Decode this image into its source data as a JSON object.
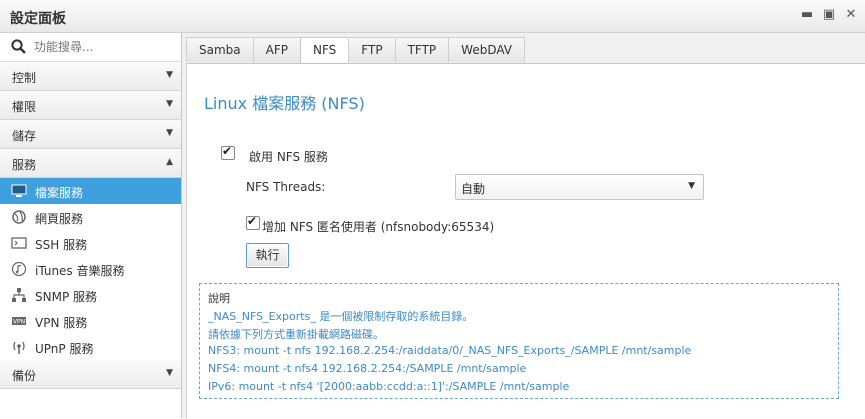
{
  "window": {
    "title": "設定面板",
    "controls": [
      "minimize-icon",
      "maximize-icon",
      "close-icon"
    ]
  },
  "sidebar": {
    "search_placeholder": "功能搜尋...",
    "categories": {
      "control": "控制",
      "permission": "權限",
      "storage": "儲存",
      "services": "服務",
      "backup": "備份"
    },
    "service_items": [
      {
        "label": "檔案服務",
        "icon": "monitor-icon",
        "active": true
      },
      {
        "label": "網頁服務",
        "icon": "globe-icon",
        "active": false
      },
      {
        "label": "SSH 服務",
        "icon": "terminal-icon",
        "active": false
      },
      {
        "label": "iTunes 音樂服務",
        "icon": "music-note-icon",
        "active": false
      },
      {
        "label": "SNMP 服務",
        "icon": "network-tree-icon",
        "active": false
      },
      {
        "label": "VPN 服務",
        "icon": "vpn-icon",
        "active": false
      },
      {
        "label": "UPnP 服務",
        "icon": "antenna-icon",
        "active": false
      }
    ]
  },
  "tabs": [
    "Samba",
    "AFP",
    "NFS",
    "FTP",
    "TFTP",
    "WebDAV"
  ],
  "active_tab": "NFS",
  "nfs": {
    "heading": "Linux 檔案服務 (NFS)",
    "enable_label": "啟用 NFS 服務",
    "enable_checked": true,
    "threads_label": "NFS Threads:",
    "threads_value": "自動",
    "anon_label": "增加 NFS 匿名使用者 (nfsnobody:65534)",
    "anon_checked": true,
    "apply_button": "執行"
  },
  "info": {
    "title": "說明",
    "lines": [
      "_NAS_NFS_Exports_ 是一個被限制存取的系統目錄。",
      "請依據下列方式重新掛載網路磁碟。",
      "NFS3: mount -t nfs 192.168.2.254:/raiddata/0/_NAS_NFS_Exports_/SAMPLE /mnt/sample",
      "NFS4: mount -t nfs4 192.168.2.254:/SAMPLE /mnt/sample",
      "IPv6: mount -t nfs4 '[2000:aabb:ccdd:a::1]':/SAMPLE /mnt/sample"
    ]
  },
  "colors": {
    "accent": "#3ea0dc",
    "heading": "#3d8ac7"
  }
}
